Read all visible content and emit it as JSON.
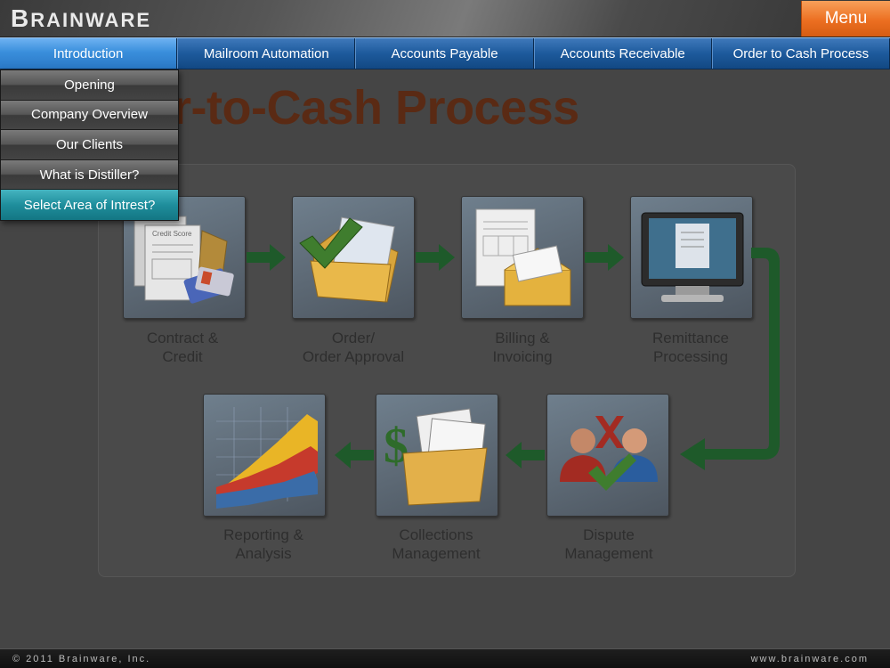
{
  "header": {
    "logo_first": "B",
    "logo_rest": "RAINWARE",
    "menu_label": "Menu"
  },
  "tabs": [
    {
      "label": "Introduction",
      "active": true
    },
    {
      "label": "Mailroom Automation",
      "active": false
    },
    {
      "label": "Accounts Payable",
      "active": false
    },
    {
      "label": "Accounts Receivable",
      "active": false
    },
    {
      "label": "Order to Cash Process",
      "active": false
    }
  ],
  "dropdown": {
    "items": [
      {
        "label": "Opening"
      },
      {
        "label": "Company Overview"
      },
      {
        "label": "Our Clients"
      },
      {
        "label": "What is Distiller?"
      },
      {
        "label": "Select Area of Intrest?",
        "selected": true
      }
    ]
  },
  "content": {
    "heading": "Order-to-Cash Process",
    "steps": [
      {
        "line1": "Contract &",
        "line2": "Credit",
        "icon": "credit-documents-icon"
      },
      {
        "line1": "Order/",
        "line2": "Order Approval",
        "icon": "approval-folder-icon"
      },
      {
        "line1": "Billing &",
        "line2": "Invoicing",
        "icon": "invoice-envelope-icon"
      },
      {
        "line1": "Remittance",
        "line2": "Processing",
        "icon": "monitor-icon"
      },
      {
        "line1": "Dispute",
        "line2": "Management",
        "icon": "dispute-people-icon"
      },
      {
        "line1": "Collections",
        "line2": "Management",
        "icon": "collections-folder-icon"
      },
      {
        "line1": "Reporting &",
        "line2": "Analysis",
        "icon": "reporting-chart-icon"
      }
    ],
    "card_title_text": "Credit Score"
  },
  "footer": {
    "copyright": "© 2011 Brainware, Inc.",
    "website": "www.brainware.com"
  },
  "colors": {
    "accent_orange": "#ec6f21",
    "tab_blue": "#1d5a9c",
    "selected_teal": "#1f8e9c",
    "arrow_green": "#1e5a2a"
  }
}
